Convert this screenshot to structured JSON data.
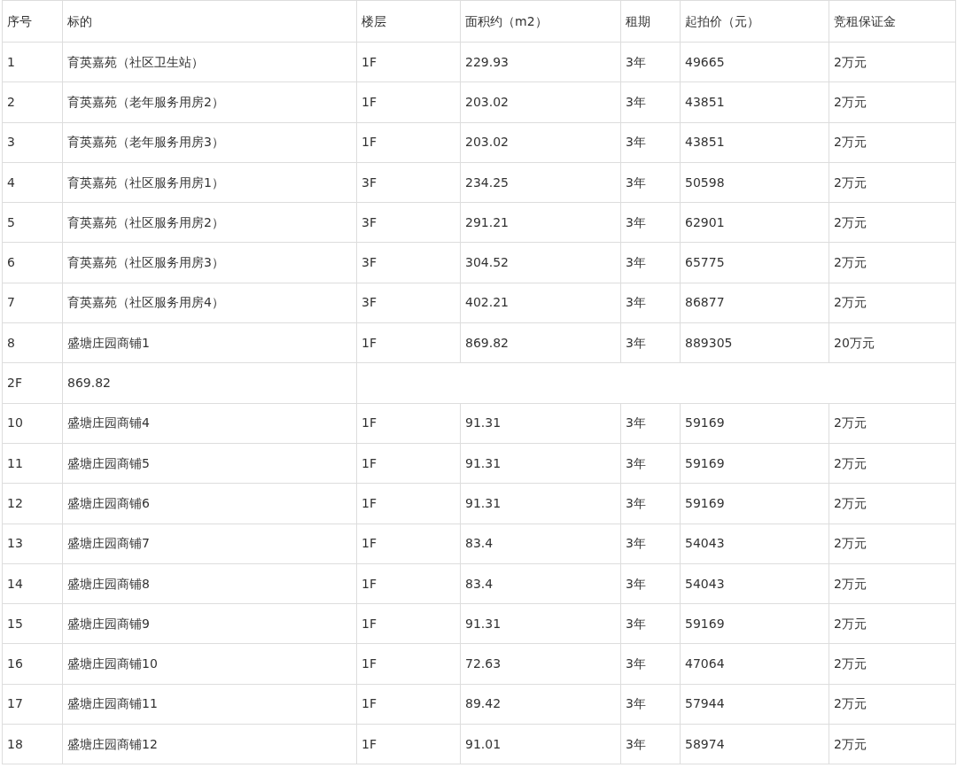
{
  "table": {
    "columns": [
      "序号",
      "标的",
      "楼层",
      "面积约（m2）",
      "租期",
      "起拍价（元）",
      "竞租保证金"
    ],
    "rows": [
      [
        "1",
        "育英嘉苑（社区卫生站）",
        "1F",
        "229.93",
        "3年",
        "49665",
        "2万元"
      ],
      [
        "2",
        "育英嘉苑（老年服务用房2）",
        "1F",
        "203.02",
        "3年",
        "43851",
        "2万元"
      ],
      [
        "3",
        "育英嘉苑（老年服务用房3）",
        "1F",
        "203.02",
        "3年",
        "43851",
        "2万元"
      ],
      [
        "4",
        "育英嘉苑（社区服务用房1）",
        "3F",
        "234.25",
        "3年",
        "50598",
        "2万元"
      ],
      [
        "5",
        "育英嘉苑（社区服务用房2）",
        "3F",
        "291.21",
        "3年",
        "62901",
        "2万元"
      ],
      [
        "6",
        "育英嘉苑（社区服务用房3）",
        "3F",
        "304.52",
        "3年",
        "65775",
        "2万元"
      ],
      [
        "7",
        "育英嘉苑（社区服务用房4）",
        "3F",
        "402.21",
        "3年",
        "86877",
        "2万元"
      ],
      [
        "8",
        "盛塘庄园商铺1",
        "1F",
        "869.82",
        "3年",
        "889305",
        "20万元"
      ],
      [
        "2F",
        "869.82"
      ],
      [
        "10",
        "盛塘庄园商铺4",
        "1F",
        "91.31",
        "3年",
        "59169",
        "2万元"
      ],
      [
        "11",
        "盛塘庄园商铺5",
        "1F",
        "91.31",
        "3年",
        "59169",
        "2万元"
      ],
      [
        "12",
        "盛塘庄园商铺6",
        "1F",
        "91.31",
        "3年",
        "59169",
        "2万元"
      ],
      [
        "13",
        "盛塘庄园商铺7",
        "1F",
        "83.4",
        "3年",
        "54043",
        "2万元"
      ],
      [
        "14",
        "盛塘庄园商铺8",
        "1F",
        "83.4",
        "3年",
        "54043",
        "2万元"
      ],
      [
        "15",
        "盛塘庄园商铺9",
        "1F",
        "91.31",
        "3年",
        "59169",
        "2万元"
      ],
      [
        "16",
        "盛塘庄园商铺10",
        "1F",
        "72.63",
        "3年",
        "47064",
        "2万元"
      ],
      [
        "17",
        "盛塘庄园商铺11",
        "1F",
        "89.42",
        "3年",
        "57944",
        "2万元"
      ],
      [
        "18",
        "盛塘庄园商铺12",
        "1F",
        "91.01",
        "3年",
        "58974",
        "2万元"
      ]
    ]
  }
}
